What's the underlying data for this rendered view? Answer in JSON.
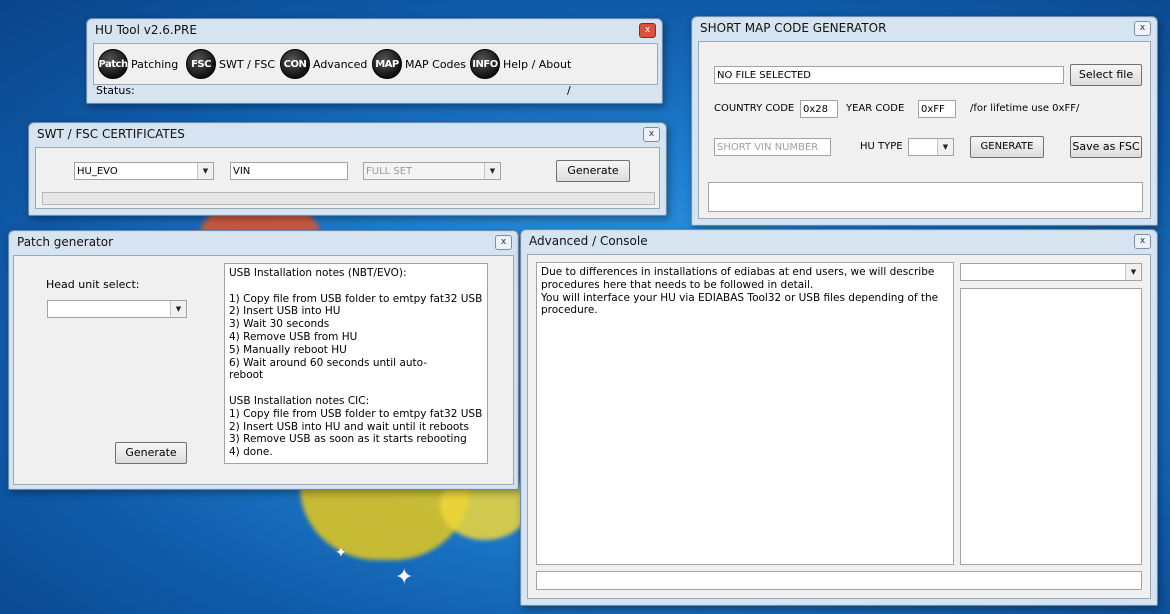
{
  "hu_tool": {
    "title": "HU Tool v2.6.PRE",
    "toolbar": [
      {
        "icon": "Patch",
        "label": "Patching"
      },
      {
        "icon": "FSC",
        "label": "SWT / FSC"
      },
      {
        "icon": "CON",
        "label": "Advanced"
      },
      {
        "icon": "MAP",
        "label": "MAP Codes"
      },
      {
        "icon": "INFO",
        "label": "Help / About"
      }
    ],
    "status_label": "Status:",
    "status_sep": "/"
  },
  "swt_fsc": {
    "title": "SWT / FSC CERTIFICATES",
    "model_value": "HU_EVO",
    "vin_value": "VIN",
    "set_value": "FULL SET",
    "generate_label": "Generate"
  },
  "patch_gen": {
    "title": "Patch generator",
    "head_unit_label": "Head unit select:",
    "head_unit_value": "",
    "notes": "USB Installation notes (NBT/EVO):\n\n1) Copy file from USB folder to emtpy fat32 USB\n2) Insert USB into HU\n3) Wait 30 seconds\n4) Remove USB from HU\n5) Manually reboot HU\n6) Wait around 60 seconds until auto-\nreboot\n\nUSB Installation notes CIC:\n1) Copy file from USB folder to emtpy fat32 USB\n2) Insert USB into HU and wait until it reboots\n3) Remove USB as soon as it starts rebooting\n4) done.",
    "generate_label": "Generate"
  },
  "map_gen": {
    "title": "SHORT MAP CODE GENERATOR",
    "file_value": "NO FILE SELECTED",
    "select_file_label": "Select file",
    "country_code_label": "COUNTRY CODE",
    "country_code_value": "0x28",
    "year_code_label": "YEAR CODE",
    "year_code_value": "0xFF",
    "lifetime_note": "/for lifetime use 0xFF/",
    "vin_placeholder": "SHORT VIN NUMBER",
    "hu_type_label": "HU TYPE",
    "generate_label": "GENERATE",
    "save_fsc_label": "Save as FSC"
  },
  "advanced": {
    "title": "Advanced / Console",
    "console_text": "Due to differences in installations of ediabas at end users, we will describe procedures here that needs to be followed in detail.\nYou will interface your HU via EDIABAS Tool32 or USB files depending of the procedure."
  },
  "close_glyph": "x"
}
